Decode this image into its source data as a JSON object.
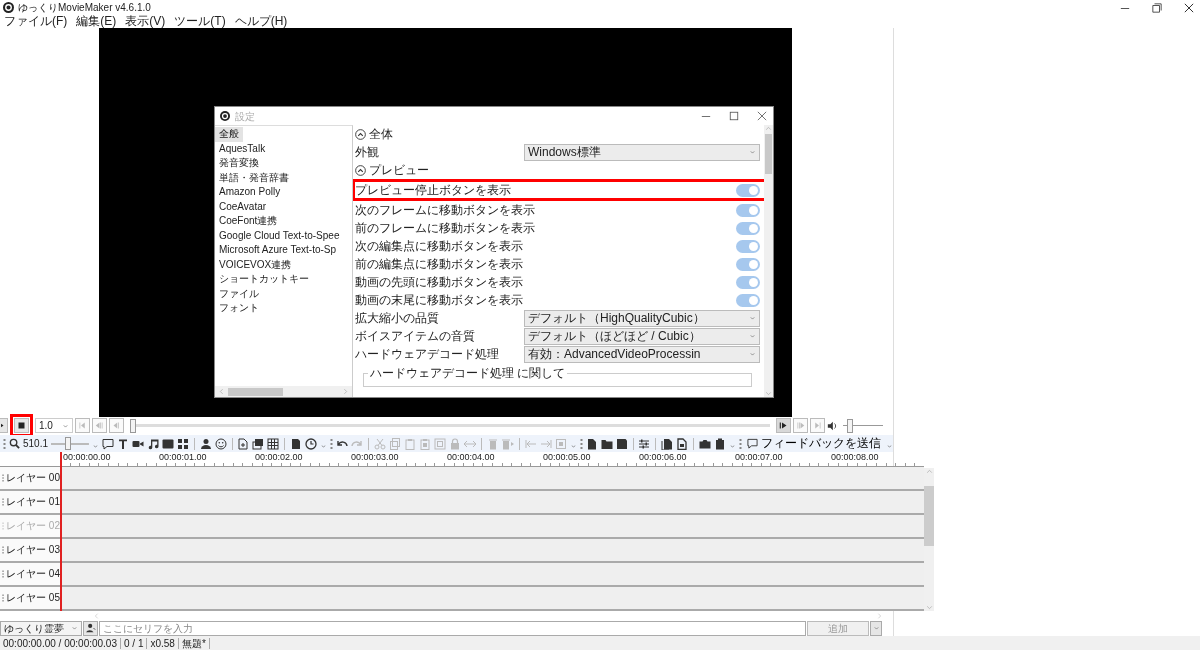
{
  "window": {
    "title": "ゆっくりMovieMaker v4.6.1.0"
  },
  "menu": [
    "ファイル(F)",
    "編集(E)",
    "表示(V)",
    "ツール(T)",
    "ヘルプ(H)"
  ],
  "settings_dialog": {
    "title": "設定",
    "categories": [
      {
        "label": "全般",
        "selected": true
      },
      {
        "label": "AquesTalk",
        "selected": false
      },
      {
        "label": "発音変換",
        "selected": false
      },
      {
        "label": "単語・発音辞書",
        "selected": false
      },
      {
        "label": "Amazon Polly",
        "selected": false
      },
      {
        "label": "CoeAvatar",
        "selected": false
      },
      {
        "label": "CoeFont連携",
        "selected": false
      },
      {
        "label": "Google Cloud Text-to-Spee",
        "selected": false
      },
      {
        "label": "Microsoft Azure Text-to-Sp",
        "selected": false
      },
      {
        "label": "VOICEVOX連携",
        "selected": false
      },
      {
        "label": "ショートカットキー",
        "selected": false
      },
      {
        "label": "ファイル",
        "selected": false
      },
      {
        "label": "フォント",
        "selected": false
      }
    ],
    "rows": [
      {
        "kind": "section",
        "label": "全体",
        "expanded": true
      },
      {
        "kind": "select",
        "label": "外観",
        "value": "Windows標準"
      },
      {
        "kind": "section",
        "label": "プレビュー",
        "expanded": true
      },
      {
        "kind": "toggle",
        "label": "プレビュー停止ボタンを表示",
        "on": true,
        "highlighted": true
      },
      {
        "kind": "toggle",
        "label": "次のフレームに移動ボタンを表示",
        "on": true,
        "highlighted": false
      },
      {
        "kind": "toggle",
        "label": "前のフレームに移動ボタンを表示",
        "on": true,
        "highlighted": false
      },
      {
        "kind": "toggle",
        "label": "次の編集点に移動ボタンを表示",
        "on": true,
        "highlighted": false
      },
      {
        "kind": "toggle",
        "label": "前の編集点に移動ボタンを表示",
        "on": true,
        "highlighted": false
      },
      {
        "kind": "toggle",
        "label": "動画の先頭に移動ボタンを表示",
        "on": true,
        "highlighted": false
      },
      {
        "kind": "toggle",
        "label": "動画の末尾に移動ボタンを表示",
        "on": true,
        "highlighted": false
      },
      {
        "kind": "select",
        "label": "拡大縮小の品質",
        "value": "デフォルト（HighQualityCubic）"
      },
      {
        "kind": "select",
        "label": "ボイスアイテムの音質",
        "value": "デフォルト（ほどほど / Cubic）"
      },
      {
        "kind": "select",
        "label": "ハードウェアデコード処理",
        "value": "有効：AdvancedVideoProcessin"
      },
      {
        "kind": "group",
        "label": "ハードウェアデコード処理 に関して"
      }
    ]
  },
  "playback": {
    "stop_highlighted": true,
    "speed": "1.0",
    "seek": {
      "level": 0
    },
    "volume": {
      "level": 0.12
    }
  },
  "toolbar": {
    "zoom": "510.1",
    "zoom_slider": {
      "level": 0.45
    },
    "tools": [
      {
        "disabled": false
      },
      {
        "disabled": false
      },
      {
        "disabled": false
      },
      {
        "disabled": false
      },
      {
        "disabled": false
      },
      {
        "disabled": false
      },
      {
        "disabled": false
      },
      {
        "disabled": false
      },
      {
        "disabled": false
      },
      {
        "disabled": false
      },
      {
        "disabled": false
      },
      {
        "disabled": false
      },
      {
        "disabled": false
      },
      {
        "disabled": false
      },
      {
        "disabled": true
      },
      {
        "disabled": true
      },
      {
        "disabled": true
      },
      {
        "disabled": true
      },
      {
        "disabled": true
      },
      {
        "disabled": true
      },
      {
        "disabled": true
      },
      {
        "disabled": true
      },
      {
        "disabled": true
      },
      {
        "disabled": true
      },
      {
        "disabled": true
      },
      {
        "disabled": true
      },
      {
        "disabled": true
      },
      {
        "disabled": false
      },
      {
        "disabled": false
      },
      {
        "disabled": false
      },
      {
        "disabled": false
      },
      {
        "disabled": false
      },
      {
        "disabled": false
      },
      {
        "disabled": false
      },
      {
        "disabled": false
      }
    ],
    "feedback": "フィードバックを送信"
  },
  "timeline": {
    "ticks": [
      "00:00:00.00",
      "00:00:01.00",
      "00:00:02.00",
      "00:00:03.00",
      "00:00:04.00",
      "00:00:05.00",
      "00:00:06.00",
      "00:00:07.00",
      "00:00:08.00"
    ],
    "layers": [
      {
        "label": "レイヤー 00",
        "visible": true
      },
      {
        "label": "レイヤー 01",
        "visible": true
      },
      {
        "label": "レイヤー 02",
        "visible": false
      },
      {
        "label": "レイヤー 03",
        "visible": true
      },
      {
        "label": "レイヤー 04",
        "visible": true
      },
      {
        "label": "レイヤー 05",
        "visible": true
      }
    ]
  },
  "input_bar": {
    "character": "ゆっくり霊夢",
    "placeholder": "ここにセリフを入力",
    "add_button": "追加",
    "add_disabled": true
  },
  "status_bar": [
    "00:00:00.00 / 00:00:00.03",
    "0 / 1",
    "x0.58",
    "無題*"
  ]
}
